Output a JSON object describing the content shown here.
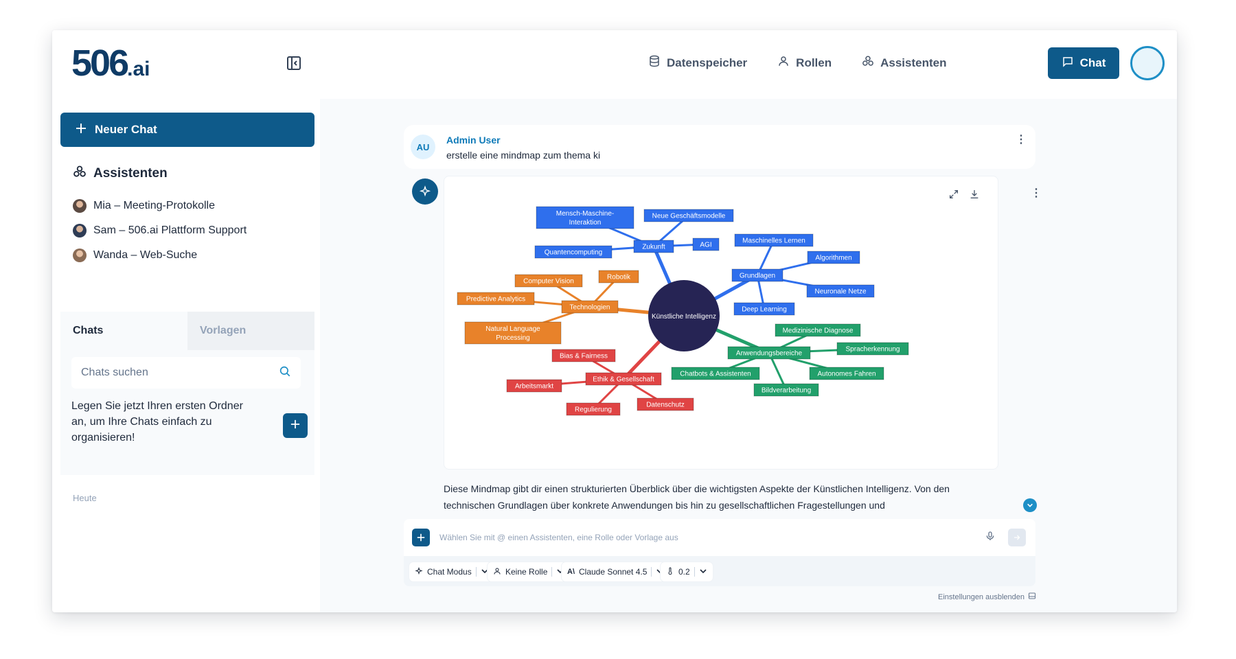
{
  "brand": {
    "logo_number": "506",
    "logo_suffix": ".ai"
  },
  "nav": {
    "items": [
      {
        "label": "Datenspeicher",
        "icon": "database-icon"
      },
      {
        "label": "Rollen",
        "icon": "user-icon"
      },
      {
        "label": "Assistenten",
        "icon": "assistants-icon"
      }
    ],
    "chat_button": "Chat"
  },
  "sidebar": {
    "new_chat": "Neuer Chat",
    "assistants_title": "Assistenten",
    "assistants": [
      {
        "label": "Mia – Meeting-Protokolle"
      },
      {
        "label": "Sam – 506.ai Plattform Support"
      },
      {
        "label": "Wanda – Web-Suche"
      }
    ],
    "tabs": [
      {
        "label": "Chats"
      },
      {
        "label": "Vorlagen"
      }
    ],
    "search_placeholder": "Chats suchen",
    "folder_hint": "Legen Sie jetzt Ihren ersten Ordner an, um Ihre Chats einfach zu organisieren!",
    "today_label": "Heute"
  },
  "conversation": {
    "user_initials": "AU",
    "user_name": "Admin User",
    "user_message": "erstelle eine mindmap zum thema ki",
    "answer_text": "Diese Mindmap gibt dir einen strukturierten Überblick über die wichtigsten Aspekte der Künstlichen Intelligenz. Von den technischen Grundlagen über konkrete Anwendungen bis hin zu gesellschaftlichen Fragestellungen und"
  },
  "mindmap": {
    "center": "Künstliche Intelligenz",
    "colors": {
      "center": "#262454",
      "blue": "#2f6fed",
      "orange": "#e8822a",
      "green": "#22a06b",
      "red": "#e04444"
    },
    "nodes": [
      {
        "id": "zukunft",
        "label": "Zukunft",
        "color": "blue"
      },
      {
        "id": "mmi",
        "label": "Mensch-Maschine-Interaktion",
        "color": "blue"
      },
      {
        "id": "ngm",
        "label": "Neue Geschäftsmodelle",
        "color": "blue"
      },
      {
        "id": "agi",
        "label": "AGI",
        "color": "blue"
      },
      {
        "id": "qc",
        "label": "Quantencomputing",
        "color": "blue"
      },
      {
        "id": "grund",
        "label": "Grundlagen",
        "color": "blue"
      },
      {
        "id": "ml",
        "label": "Maschinelles Lernen",
        "color": "blue"
      },
      {
        "id": "algo",
        "label": "Algorithmen",
        "color": "blue"
      },
      {
        "id": "nn",
        "label": "Neuronale Netze",
        "color": "blue"
      },
      {
        "id": "dl",
        "label": "Deep Learning",
        "color": "blue"
      },
      {
        "id": "tech",
        "label": "Technologien",
        "color": "orange"
      },
      {
        "id": "cv",
        "label": "Computer Vision",
        "color": "orange"
      },
      {
        "id": "rob",
        "label": "Robotik",
        "color": "orange"
      },
      {
        "id": "pa",
        "label": "Predictive Analytics",
        "color": "orange"
      },
      {
        "id": "nlp",
        "label": "Natural Language Processing",
        "color": "orange"
      },
      {
        "id": "anw",
        "label": "Anwendungsbereiche",
        "color": "green"
      },
      {
        "id": "med",
        "label": "Medizinische Diagnose",
        "color": "green"
      },
      {
        "id": "spr",
        "label": "Spracherkennung",
        "color": "green"
      },
      {
        "id": "auto",
        "label": "Autonomes Fahren",
        "color": "green"
      },
      {
        "id": "bild",
        "label": "Bildverarbeitung",
        "color": "green"
      },
      {
        "id": "chat",
        "label": "Chatbots & Assistenten",
        "color": "green"
      },
      {
        "id": "ethik",
        "label": "Ethik & Gesellschaft",
        "color": "red"
      },
      {
        "id": "bias",
        "label": "Bias & Fairness",
        "color": "red"
      },
      {
        "id": "arb",
        "label": "Arbeitsmarkt",
        "color": "red"
      },
      {
        "id": "reg",
        "label": "Regulierung",
        "color": "red"
      },
      {
        "id": "ds",
        "label": "Datenschutz",
        "color": "red"
      }
    ]
  },
  "composer": {
    "placeholder": "Wählen Sie mit @ einen Assistenten, eine Rolle oder Vorlage aus",
    "pills": [
      {
        "label": "Chat Modus",
        "icon": "sparkle-icon"
      },
      {
        "label": "Keine Rolle",
        "icon": "user-icon"
      },
      {
        "label": "Claude Sonnet 4.5",
        "icon": "anthropic-icon"
      },
      {
        "label": "0.2",
        "icon": "thermometer-icon"
      }
    ],
    "hide_settings": "Einstellungen ausblenden"
  }
}
